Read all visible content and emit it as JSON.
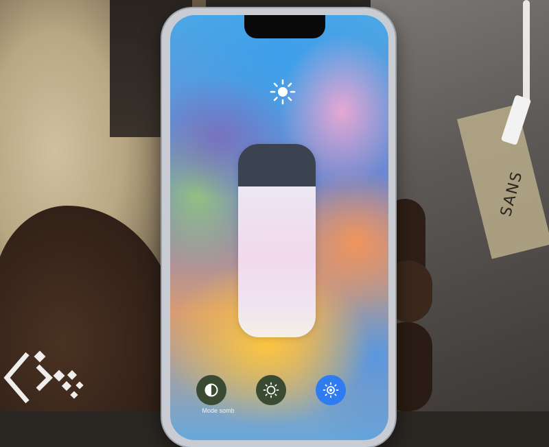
{
  "background": {
    "label_handwriting": "SANS"
  },
  "control_center": {
    "brightness": {
      "icon": "sun-icon",
      "level_fraction": 0.78
    },
    "buttons": [
      {
        "icon": "contrast-icon",
        "label": "Mode somb",
        "color": "#3b4a33"
      },
      {
        "icon": "night-shift-icon",
        "label": "",
        "color": "#3b4a33"
      },
      {
        "icon": "true-tone-icon",
        "label": "",
        "color": "#2f7cf2"
      }
    ]
  },
  "colors": {
    "accent_blue": "#2f7cf2",
    "slider_track": "#3c4350"
  },
  "watermark": {
    "icon": "diamond-logo-icon"
  }
}
